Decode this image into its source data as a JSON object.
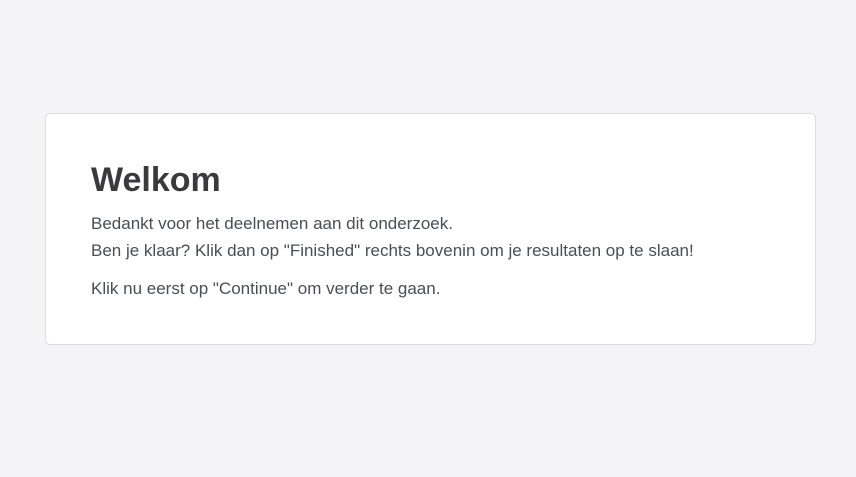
{
  "card": {
    "title": "Welkom",
    "paragraph1": {
      "line1": "Bedankt voor het deelnemen aan dit onderzoek.",
      "line2": "Ben je klaar? Klik dan op \"Finished\" rechts bovenin om je resultaten op te slaan!"
    },
    "paragraph2": "Klik nu eerst op \"Continue\" om verder te gaan."
  },
  "colors": {
    "page_background": "#f4f4f6",
    "card_background": "#ffffff",
    "card_border": "#dcdde2",
    "title_text": "#3a3a3c",
    "body_text": "#4b4d57"
  }
}
